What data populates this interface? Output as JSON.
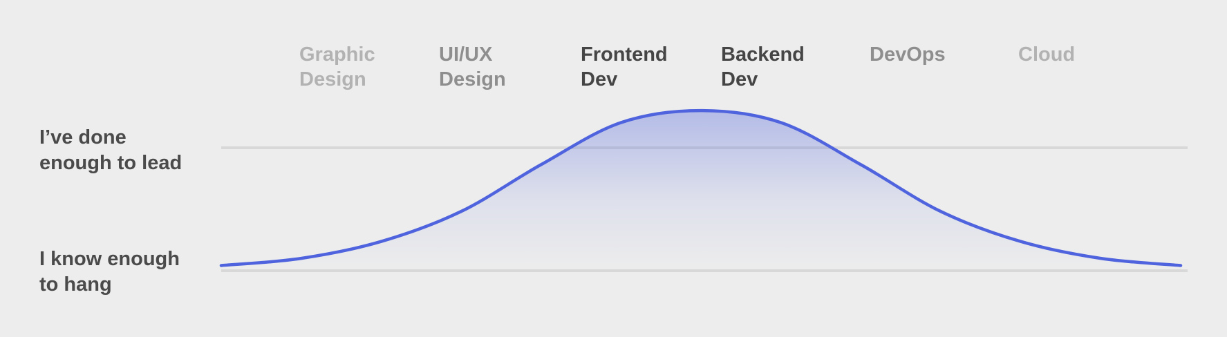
{
  "chart_data": {
    "type": "area",
    "title": "",
    "xlabel": "",
    "ylabel": "",
    "categories": [
      {
        "line1": "Graphic",
        "line2": "Design",
        "emphasis": "faint"
      },
      {
        "line1": "UI/UX",
        "line2": "Design",
        "emphasis": "medium"
      },
      {
        "line1": "Frontend",
        "line2": "Dev",
        "emphasis": "strong"
      },
      {
        "line1": "Backend",
        "line2": "Dev",
        "emphasis": "strong"
      },
      {
        "line1": "DevOps",
        "line2": "",
        "emphasis": "medium"
      },
      {
        "line1": "Cloud",
        "line2": "",
        "emphasis": "faint"
      }
    ],
    "y_levels": [
      {
        "line1": "I’ve done",
        "line2": "enough to lead",
        "value": 1.0
      },
      {
        "line1": "I know enough",
        "line2": "to hang",
        "value": 0.0
      }
    ],
    "ylim": [
      0.0,
      1.0
    ],
    "grid": true,
    "series": [
      {
        "color": "#4e63dd",
        "x": [
          0.0,
          0.5,
          1.0,
          1.5,
          2.0,
          2.5,
          3.0,
          3.5,
          4.0,
          4.5,
          5.0,
          5.5,
          6.0
        ],
        "values": [
          0.02,
          0.08,
          0.22,
          0.47,
          0.86,
          1.21,
          1.31,
          1.21,
          0.86,
          0.47,
          0.22,
          0.08,
          0.02
        ]
      }
    ],
    "colors": {
      "faint": "#b2b2b2",
      "medium": "#8e8e8e",
      "strong": "#454545",
      "y_label": "#4a4a4a",
      "gridline": "#d8d8d8",
      "background": "#ededed"
    }
  }
}
